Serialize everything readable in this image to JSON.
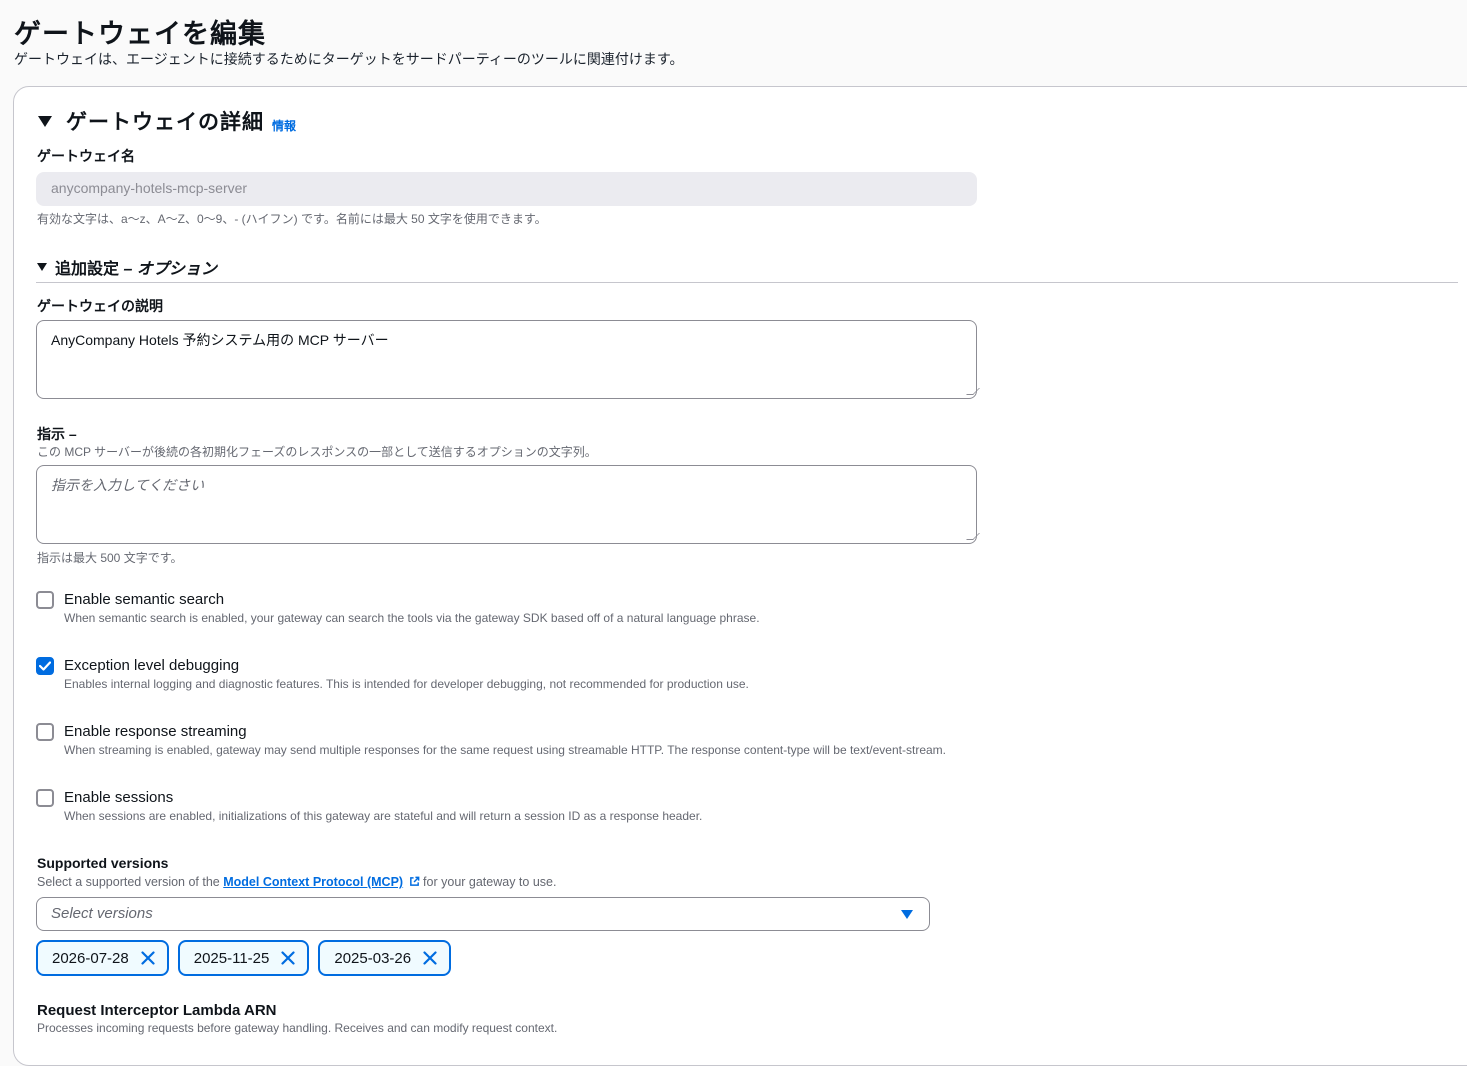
{
  "page": {
    "title": "ゲートウェイを編集",
    "subtitle": "ゲートウェイは、エージェントに接続するためにターゲットをサードパーティーのツールに関連付けます。"
  },
  "details": {
    "title": "ゲートウェイの詳細",
    "info_link": "情報",
    "name_label": "ゲートウェイ名",
    "name_value": "anycompany-hotels-mcp-server",
    "name_hint": "有効な文字は、a〜z、A〜Z、0〜9、- (ハイフン) です。名前には最大 50 文字を使用できます。"
  },
  "additional": {
    "title": "追加設定",
    "title_optional": "– オプション",
    "description_label": "ゲートウェイの説明",
    "description_value": "AnyCompany Hotels 予約システム用の MCP サーバー",
    "instructions_label": "指示 –",
    "instructions_hint": "この MCP サーバーが後続の各初期化フェーズのレスポンスの一部として送信するオプションの文字列。",
    "instructions_placeholder": "指示を入力してください",
    "instructions_limit": "指示は最大 500 文字です。"
  },
  "options": [
    {
      "label": "Enable semantic search",
      "description": "When semantic search is enabled, your gateway can search the tools via the gateway SDK based off of a natural language phrase.",
      "checked": false
    },
    {
      "label": "Exception level debugging",
      "description": "Enables internal logging and diagnostic features. This is intended for developer debugging, not recommended for production use.",
      "checked": true
    },
    {
      "label": "Enable response streaming",
      "description": "When streaming is enabled, gateway may send multiple responses for the same request using streamable HTTP. The response content-type will be text/event-stream.",
      "checked": false
    },
    {
      "label": "Enable sessions",
      "description": "When sessions are enabled, initializations of this gateway are stateful and will return a session ID as a response header.",
      "checked": false
    }
  ],
  "versions": {
    "label": "Supported versions",
    "hint_before": "Select a supported version of the ",
    "hint_link": "Model Context Protocol (MCP)",
    "hint_after": " for your gateway to use.",
    "select_placeholder": "Select versions",
    "selected": [
      "2026-07-28",
      "2025-11-25",
      "2025-03-26"
    ]
  },
  "interceptor": {
    "label": "Request Interceptor Lambda ARN",
    "hint": "Processes incoming requests before gateway handling. Receives and can modify request context."
  },
  "colors": {
    "accent": "#006ce0",
    "text": "#0f141a",
    "muted": "#656871"
  }
}
